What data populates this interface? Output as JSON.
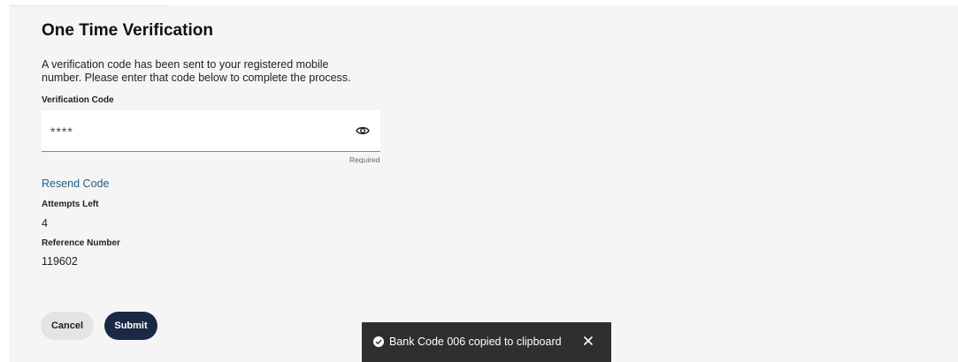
{
  "page": {
    "title": "One Time Verification",
    "description": "A verification code has been sent to your registered mobile number. Please enter that code below to complete the process."
  },
  "verification": {
    "label": "Verification Code",
    "value": "****",
    "required_text": "Required",
    "toggle_icon": "eye-icon"
  },
  "resend_label": "Resend Code",
  "attempts": {
    "label": "Attempts Left",
    "value": "4"
  },
  "reference": {
    "label": "Reference Number",
    "value": "119602"
  },
  "buttons": {
    "cancel": "Cancel",
    "submit": "Submit"
  },
  "toast": {
    "message": "Bank Code 006 copied to clipboard",
    "icon": "check-circle-icon",
    "close_icon": "close-icon"
  },
  "colors": {
    "link": "#1f5e86",
    "primary_button": "#1b2a44",
    "toast_bg": "#2f2f2f",
    "panel_bg": "#f5f5f5"
  }
}
